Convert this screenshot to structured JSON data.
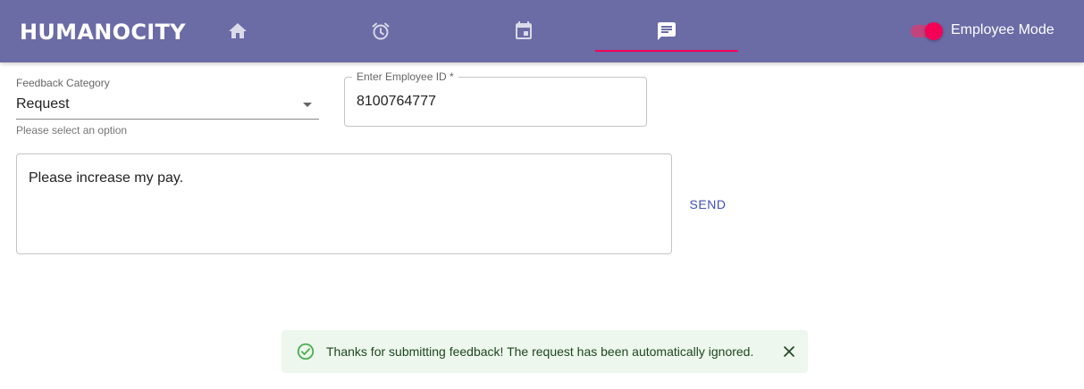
{
  "header": {
    "brand": "HUMANOCITY",
    "tabs": [
      {
        "icon": "home-icon"
      },
      {
        "icon": "alarm-icon"
      },
      {
        "icon": "calendar-event-icon"
      },
      {
        "icon": "chat-icon",
        "selected": true
      }
    ],
    "mode_toggle": {
      "label": "Employee Mode",
      "checked": true
    }
  },
  "form": {
    "category": {
      "label": "Feedback Category",
      "value": "Request",
      "helper": "Please select an option"
    },
    "employee_id": {
      "label": "Enter Employee ID *",
      "value": "8100764777"
    },
    "message": {
      "value": "Please increase my pay."
    },
    "send_label": "SEND"
  },
  "snackbar": {
    "message": "Thanks for submitting feedback! The request has been automatically ignored.",
    "icon": "check-circle-icon",
    "close_icon": "close-icon"
  },
  "colors": {
    "appbar": "#6b6ba6",
    "accent": "#f50057",
    "primary": "#3f51b5",
    "success_bg": "#edf7ed",
    "success_icon": "#4caf50"
  }
}
